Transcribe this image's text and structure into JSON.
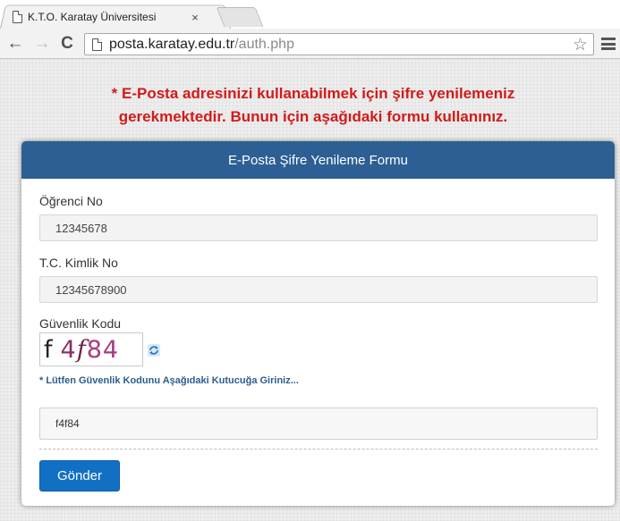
{
  "browser": {
    "tab_title": "K.T.O. Karatay Üniversitesi",
    "tab_close": "×",
    "url_host": "posta.karatay.edu.tr",
    "url_path": "/auth.php",
    "back_icon": "←",
    "forward_icon": "→",
    "reload_icon": "C",
    "star_icon": "☆"
  },
  "notice": {
    "line1": "* E-Posta adresinizi kullanabilmek için şifre yenilemeniz",
    "line2": "gerekmektedir. Bunun için aşağıdaki formu kullanınız."
  },
  "form": {
    "title": "E-Posta Şifre Yenileme Formu",
    "student_no_label": "Öğrenci No",
    "student_no_value": "12345678",
    "tc_label": "T.C. Kimlik No",
    "tc_value": "12345678900",
    "security_label": "Güvenlik Kodu",
    "captcha": {
      "char1": "f",
      "char2": "4",
      "char3": "f",
      "char4": "84"
    },
    "captcha_hint": "* Lütfen Güvenlik Kodunu Aşağıdaki Kutucuğa Giriniz...",
    "code_value": "f4f84",
    "submit_label": "Gönder"
  },
  "colors": {
    "header_blue": "#2d5f94",
    "notice_red": "#d21a1a",
    "button_blue": "#1170c4",
    "hint_blue": "#2b5d8f"
  }
}
